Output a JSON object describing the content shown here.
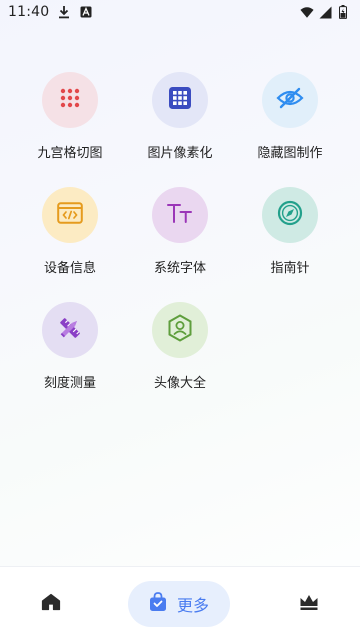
{
  "status_bar": {
    "time": "11:40",
    "icons": [
      "download-icon",
      "a-notification-icon",
      "wifi-icon",
      "signal-icon",
      "battery-icon"
    ]
  },
  "tools": [
    {
      "label": "九宫格切图",
      "icon": "grid-dots-icon",
      "bg": "#f5e1e6",
      "color": "#e2484b"
    },
    {
      "label": "图片像素化",
      "icon": "pixel-grid-icon",
      "bg": "#e3e6f7",
      "color": "#3b4cc0"
    },
    {
      "label": "隐藏图制作",
      "icon": "eye-off-icon",
      "bg": "#e1effa",
      "color": "#2f8df0"
    },
    {
      "label": "设备信息",
      "icon": "code-card-icon",
      "bg": "#fcebc3",
      "color": "#e59b1e"
    },
    {
      "label": "系统字体",
      "icon": "font-tt-icon",
      "bg": "#ead7f0",
      "color": "#9b36b8"
    },
    {
      "label": "指南针",
      "icon": "compass-icon",
      "bg": "#cfeae4",
      "color": "#22a08b"
    },
    {
      "label": "刻度测量",
      "icon": "ruler-pencil-icon",
      "bg": "#e4def3",
      "color": "#8a3fc6"
    },
    {
      "label": "头像大全",
      "icon": "avatar-hexagon-icon",
      "bg": "#e1efd8",
      "color": "#5e9e3c"
    }
  ],
  "bottom_nav": {
    "home": {
      "icon": "home-icon"
    },
    "more": {
      "icon": "bag-icon",
      "label": "更多"
    },
    "vip": {
      "icon": "crown-icon"
    },
    "active_color": "#4a7cf0"
  }
}
